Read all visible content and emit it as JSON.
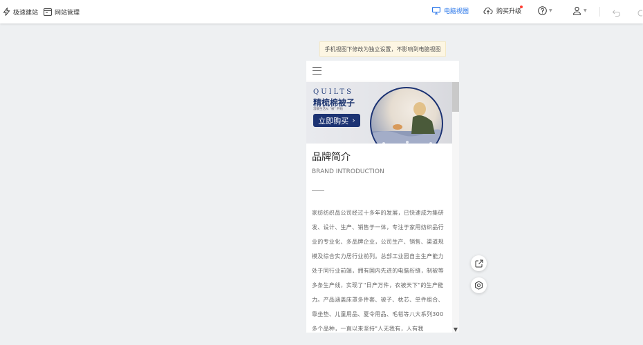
{
  "toolbar": {
    "quick_build": "极速建站",
    "site_manage": "网站管理",
    "pc_view": "电脑视图",
    "buy_upgrade": "购买升级"
  },
  "notice": "手机视图下修改为独立设置，不影响到电脑视图",
  "banner": {
    "title_en": "QUILTS",
    "title_cn": "精梳棉被子",
    "subtitle": "温暖生活从 \"被\" 开始",
    "buy_button": "立即购买",
    "buy_arrow": "›"
  },
  "brand": {
    "title": "品牌简介",
    "subtitle_en": "BRAND INTRODUCTION",
    "description": "家纺纺织品公司经过十多年的发展，已快速成为集研发、设计、生产、销售于一体，专注于家用纺织品行业的专业化、多品牌企业，公司生产、销售、渠道规模及综合实力居行业前列。总部工业园自主生产能力处于同行业前端，拥有国内先进的电脑绗缝，制被等多条生产线，实现了\"日产万件，衣被天下\"的生产能力。产品涵盖床罩多件套、被子、枕芯、单件组合、靠坐垫、儿童用品、夏令用品、毛毯等八大系列300多个品种，一直以来坚持\"人无我有，人有我"
  },
  "colors": {
    "accent": "#1e6fe8",
    "banner_navy": "#1c3373",
    "notice_bg": "#fdf6e3",
    "badge_red": "#ff3b30"
  },
  "icons": {
    "quick_build": "lightning-icon",
    "site_manage": "window-icon",
    "pc_view": "monitor-icon",
    "buy": "cloud-upload-icon",
    "help": "question-circle-icon",
    "user": "user-icon",
    "undo": "undo-icon",
    "redo": "redo-icon",
    "menu": "hamburger-icon",
    "share": "share-icon",
    "settings": "gear-icon",
    "scroll_down": "chevron-down-icon"
  }
}
